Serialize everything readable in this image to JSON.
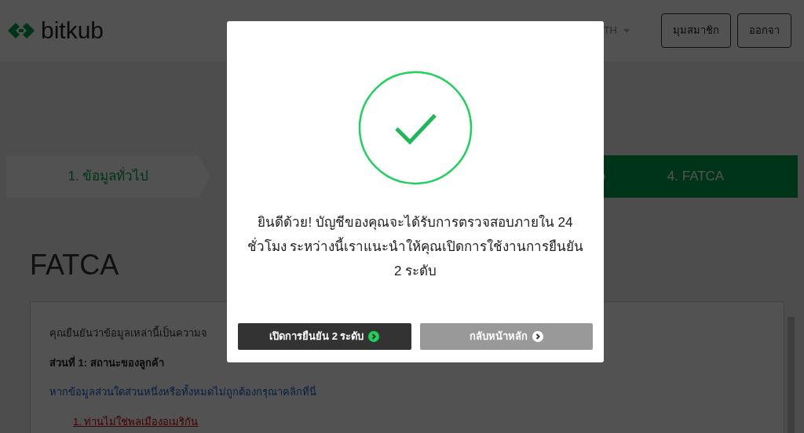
{
  "header": {
    "logo": "bitkub",
    "language": "TH",
    "buttons": [
      "มุมสมาชิก",
      "ออกจา"
    ]
  },
  "steps": [
    {
      "label": "1. ข้อมูลทั่วไป",
      "selected": false
    },
    {
      "label": "4. FATCA",
      "selected": true
    }
  ],
  "page_title": "FATCA",
  "card": {
    "intro": "คุณยืนยันว่าข้อมูลเหล่านี้เป็นความจ",
    "section": "ส่วนที่ 1: สถานะของลูกค้า",
    "link": "หากข้อมูลส่วนใดส่วนหนึ่งหรือทั้งหมดไม่ถูกต้องกรุณาคลิกที่นี่",
    "item": "1. ท่านไม่ใช่พลเมืองอเมริกัน"
  },
  "modal": {
    "message": "ยินดีด้วย! บัญชีของคุณจะได้รับการตรวจสอบภายใน 24 ชั่วโมง ระหว่างนี้เราแนะนำให้คุณเปิดการใช้งานการยืนยัน 2 ระดับ",
    "buttons": [
      {
        "label": "เปิดการยืนยัน 2 ระดับ",
        "kind": "primary"
      },
      {
        "label": "กลับหน้าหลัก",
        "kind": "secondary"
      }
    ]
  }
}
